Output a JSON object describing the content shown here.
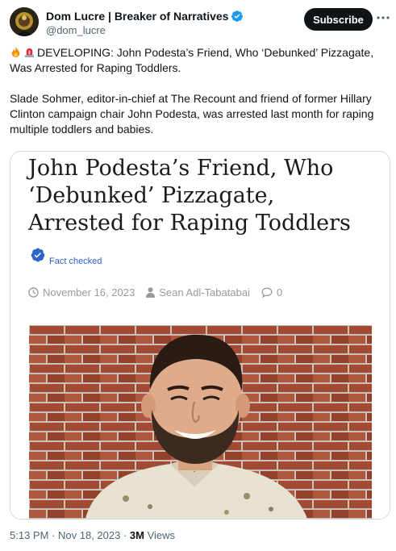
{
  "author": {
    "display_name": "Dom Lucre | Breaker of Narratives",
    "handle": "@dom_lucre",
    "verified_color": "#1d9bf0"
  },
  "actions": {
    "subscribe_label": "Subscribe",
    "more_icon": "more-horizontal-icon"
  },
  "tweet": {
    "emojis": [
      "fire-emoji",
      "rotating-light-emoji"
    ],
    "line1": "DEVELOPING: John Podesta’s Friend, Who ‘Debunked’ Pizzagate, Was Arrested for Raping Toddlers.",
    "line2": "Slade Sohmer, editor-in-chief at The Recount and friend of former Hillary Clinton campaign chair John Podesta, was arrested last month for raping multiple toddlers and babies."
  },
  "card": {
    "headline": "John Podesta’s Friend, Who ‘Debunked’ Pizzagate, Arrested for Raping Toddlers",
    "fact_check_label": "Fact checked",
    "date": "November 16, 2023",
    "author": "Sean Adl-Tabatabai",
    "comments": "0"
  },
  "footer": {
    "time": "5:13 PM",
    "date": "Nov 18, 2023",
    "views_count": "3M",
    "views_label": "Views"
  }
}
